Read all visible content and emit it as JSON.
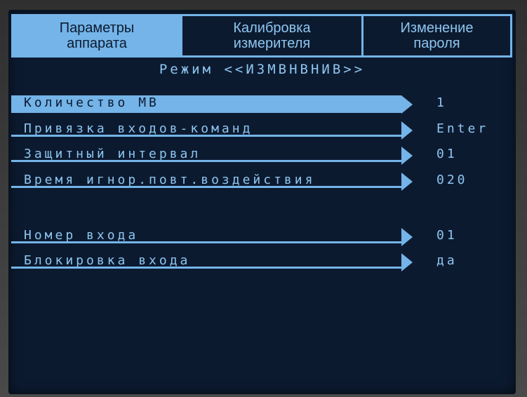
{
  "tabs": [
    {
      "line1": "Параметры",
      "line2": "аппарата",
      "active": true
    },
    {
      "line1": "Калибровка",
      "line2": "измерителя",
      "active": false
    },
    {
      "line1": "Изменение",
      "line2": "пароля",
      "active": false
    }
  ],
  "mode_label": "Режим <<ИЗМВНВНИВ>>",
  "rows": [
    {
      "label": "Количество МВ",
      "value": "1",
      "selected": true
    },
    {
      "label": "Привязка входов-команд",
      "value": "Enter",
      "selected": false
    },
    {
      "label": "Защитный интервал",
      "value": "01",
      "selected": false
    },
    {
      "label": "Время игнор.повт.воздействия",
      "value": "020",
      "selected": false
    },
    {
      "label": "Номер входа",
      "value": "01",
      "selected": false
    },
    {
      "label": "Блокировка входа",
      "value": "да",
      "selected": false
    }
  ],
  "colors": {
    "screen_bg": "#0c1a30",
    "accent": "#74b4e8",
    "text": "#8ec6ef"
  }
}
